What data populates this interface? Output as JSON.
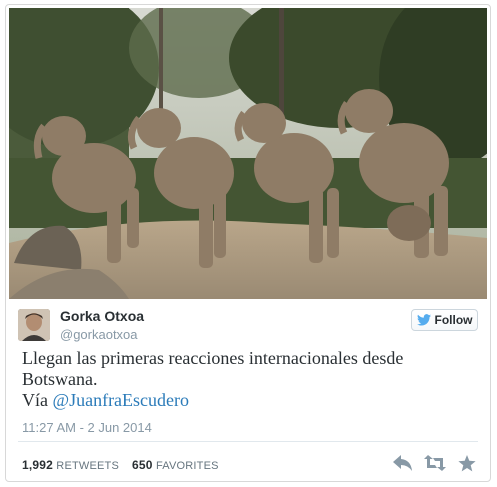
{
  "tweet": {
    "author_name": "Gorka Otxoa",
    "author_handle": "@gorkaotxoa",
    "follow_label": "Follow",
    "text_line1": "Llegan las primeras reacciones internacionales desde",
    "text_line2": "Botswana.",
    "text_via": "Vía ",
    "mention": "@JuanfraEscudero",
    "timestamp": "11:27 AM - 2 Jun 2014",
    "retweets_count": "1,992",
    "retweets_label": "RETWEETS",
    "favorites_count": "650",
    "favorites_label": "FAVORITES"
  },
  "icons": {
    "follow": "twitter-bird-icon",
    "reply": "reply-icon",
    "retweet": "retweet-icon",
    "favorite": "star-icon"
  },
  "colors": {
    "link": "#2b7bb9",
    "muted": "#8899a6",
    "follow_bird": "#55acee"
  }
}
